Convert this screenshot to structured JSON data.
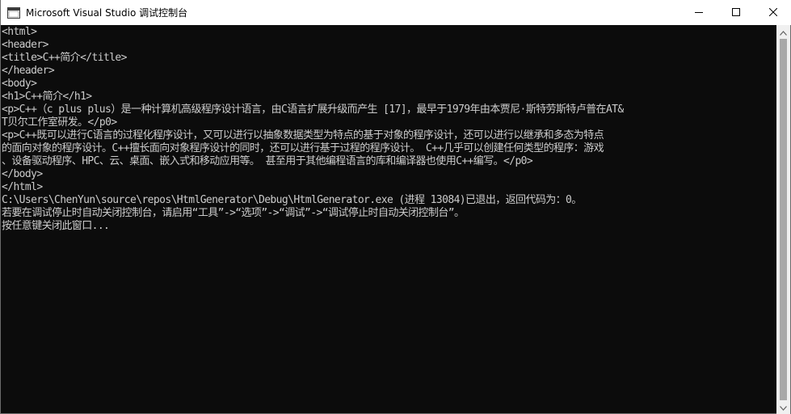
{
  "window": {
    "title": "Microsoft Visual Studio 调试控制台"
  },
  "titlebar_icons": {
    "app": "console-window-icon",
    "minimize": "minimize-icon",
    "maximize": "maximize-icon",
    "close": "close-icon"
  },
  "console": {
    "lines": [
      "<html>",
      "<header>",
      "<title>C++简介</title>",
      "</header>",
      "<body>",
      "<h1>C++简介</h1>",
      "<p>C++（c plus plus）是一种计算机高级程序设计语言，由C语言扩展升级而产生 [17]，最早于1979年由本贾尼·斯特劳斯特卢普在AT&",
      "T贝尔工作室研发。</p0>",
      "<p>C++既可以进行C语言的过程化程序设计，又可以进行以抽象数据类型为特点的基于对象的程序设计，还可以进行以继承和多态为特点",
      "的面向对象的程序设计。C++擅长面向对象程序设计的同时，还可以进行基于过程的程序设计。 C++几乎可以创建任何类型的程序：游戏",
      "、设备驱动程序、HPC、云、桌面、嵌入式和移动应用等。 甚至用于其他编程语言的库和编译器也使用C++编写。</p0>",
      "</body>",
      "</html>",
      "C:\\Users\\ChenYun\\source\\repos\\HtmlGenerator\\Debug\\HtmlGenerator.exe (进程 13084)已退出，返回代码为：0。",
      "若要在调试停止时自动关闭控制台，请启用“工具”->“选项”->“调试”->“调试停止时自动关闭控制台”。",
      "按任意键关闭此窗口..."
    ]
  },
  "colors": {
    "console_background": "#0c0c0c",
    "console_text": "#cccccc",
    "titlebar_background": "#ffffff",
    "scrollbar_track": "#f0f0f0",
    "scrollbar_thumb": "#a8a8a8"
  },
  "scrollbar": {
    "up_icon": "scroll-up-arrow-icon",
    "down_icon": "scroll-down-arrow-icon"
  }
}
